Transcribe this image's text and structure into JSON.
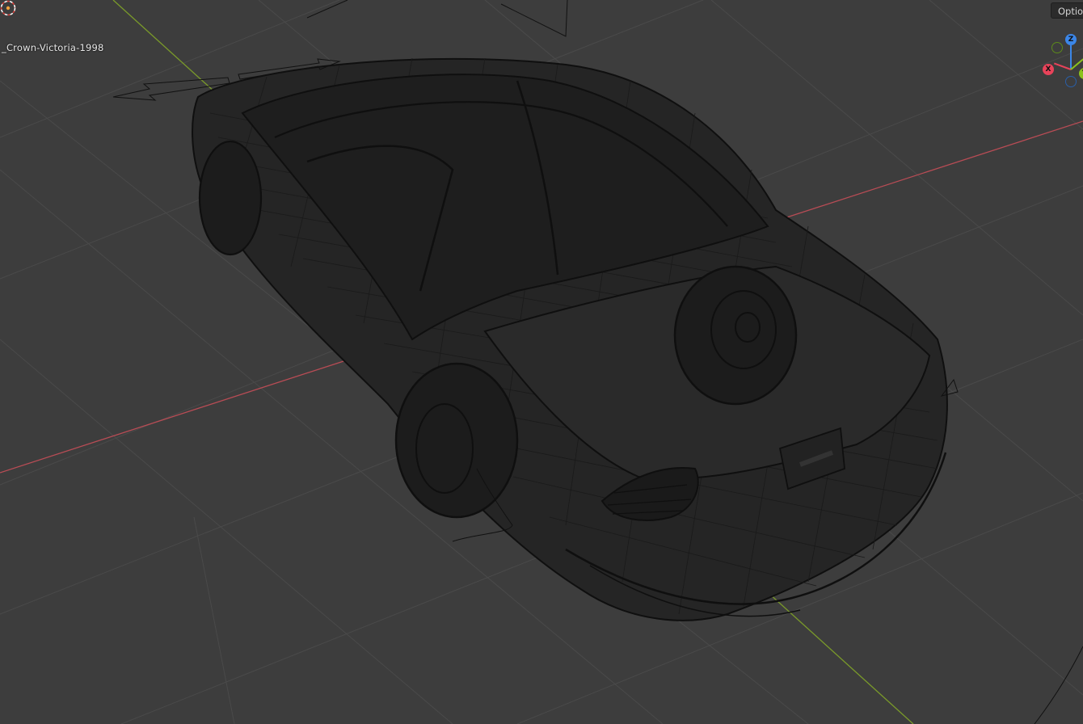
{
  "viewport": {
    "object_name": "_Crown-Victoria-1998",
    "options_label": "Optio",
    "gizmo": {
      "z_label": "Z",
      "x_label": "X",
      "y_label": "Y"
    },
    "colors": {
      "background": "#3d3d3d",
      "grid": "#4a4a4a",
      "x_axis": "#b84c55",
      "y_axis": "#7a9a2a",
      "wireframe": "#141414",
      "gizmo_x": "#e8435a",
      "gizmo_y": "#8cc21c",
      "gizmo_z": "#3b86e8"
    }
  }
}
